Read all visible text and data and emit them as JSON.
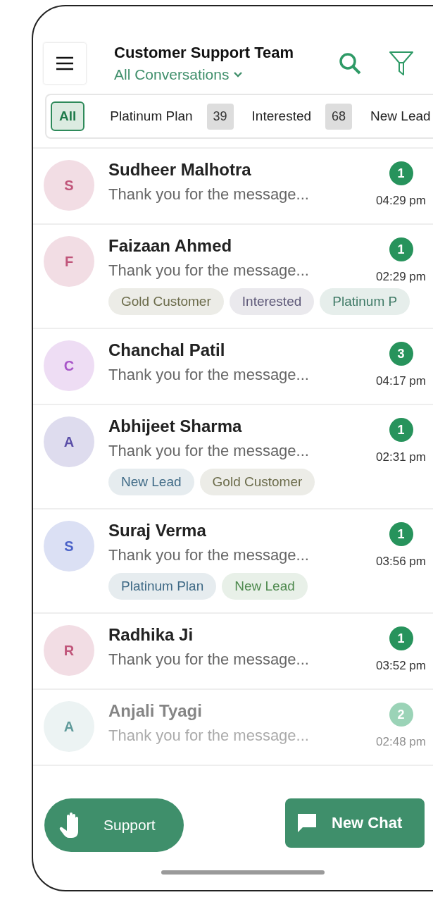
{
  "header": {
    "title": "Customer Support Team",
    "subtitle": "All Conversations"
  },
  "filters": [
    {
      "label": "All",
      "selected": true
    },
    {
      "label": "Platinum Plan",
      "count": "39",
      "selected": false
    },
    {
      "label": "Interested",
      "count": "68",
      "selected": false
    },
    {
      "label": "New Lead",
      "selected": false
    }
  ],
  "conversations": [
    {
      "initial": "S",
      "color": "#c0557a",
      "name": "Sudheer Malhotra",
      "message": "Thank you for the message...",
      "unread": "1",
      "time": "04:29 pm",
      "dimmed": false
    },
    {
      "initial": "F",
      "color": "#c0557a",
      "name": "Faizaan Ahmed",
      "message": "Thank you for the message...",
      "unread": "1",
      "time": "02:29 pm",
      "dimmed": false,
      "tags": [
        {
          "label": "Gold Customer",
          "color": "#6b6b4a"
        },
        {
          "label": "Interested",
          "color": "#5d5878"
        },
        {
          "label": "Platinum P",
          "color": "#3f7a66"
        }
      ]
    },
    {
      "initial": "C",
      "color": "#a855c8",
      "name": "Chanchal Patil",
      "message": "Thank you for the message...",
      "unread": "3",
      "time": "04:17 pm",
      "dimmed": false
    },
    {
      "initial": "A",
      "color": "#5b4fa8",
      "name": "Abhijeet Sharma",
      "message": "Thank you for the message...",
      "unread": "1",
      "time": "02:31 pm",
      "dimmed": false,
      "tags": [
        {
          "label": "New Lead",
          "color": "#3f6a86"
        },
        {
          "label": "Gold Customer",
          "color": "#6b6b4a"
        }
      ]
    },
    {
      "initial": "S",
      "color": "#4a62c8",
      "name": "Suraj Verma",
      "message": "Thank you for the message...",
      "unread": "1",
      "time": "03:56 pm",
      "dimmed": false,
      "tags": [
        {
          "label": "Platinum Plan",
          "color": "#3f6a86"
        },
        {
          "label": "New Lead",
          "color": "#4f8a4f"
        }
      ]
    },
    {
      "initial": "R",
      "color": "#c0557a",
      "name": "Radhika Ji",
      "message": "Thank you for the message...",
      "unread": "1",
      "time": "03:52 pm",
      "dimmed": false
    },
    {
      "initial": "A",
      "color": "#5f9a9a",
      "name": "Anjali Tyagi",
      "message": "Thank you for the message...",
      "unread": "2",
      "time": "02:48 pm",
      "dimmed": true
    }
  ],
  "buttons": {
    "support": "Support",
    "new_chat": "New Chat"
  }
}
